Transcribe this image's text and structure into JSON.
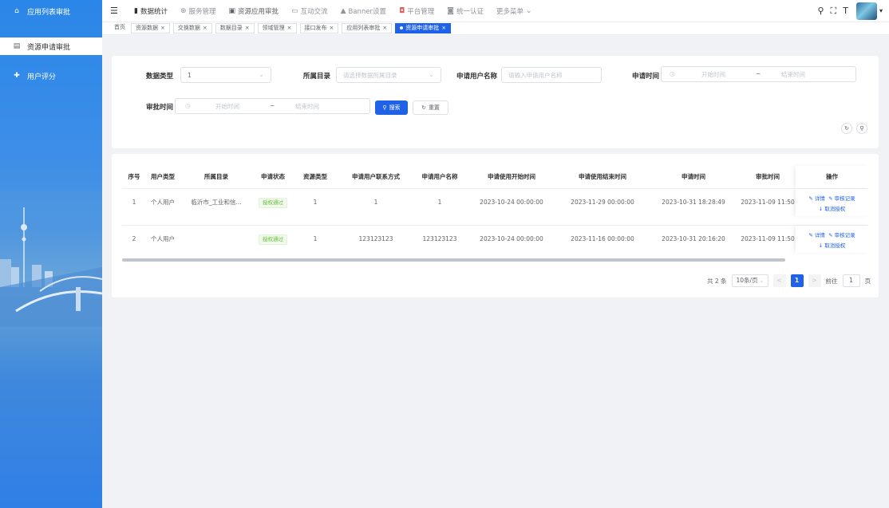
{
  "sidebar": {
    "items": [
      {
        "label": "应用列表审批",
        "icon": "home-icon",
        "glyph": "⌂"
      },
      {
        "label": "资源申请审批",
        "icon": "document-icon",
        "glyph": "▤"
      },
      {
        "label": "用户评分",
        "icon": "plus-icon",
        "glyph": "✚"
      }
    ]
  },
  "topnav": {
    "items": [
      {
        "label": "数据统计",
        "glyph": "▮"
      },
      {
        "label": "服务管理",
        "glyph": "⊕"
      },
      {
        "label": "资源应用审批",
        "glyph": "▣"
      },
      {
        "label": "互动交流",
        "glyph": "▭"
      },
      {
        "label": "Banner设置",
        "glyph": "▲"
      },
      {
        "label": "平台管理",
        "glyph": "◘"
      },
      {
        "label": "统一认证",
        "glyph": "◙"
      },
      {
        "label": "更多菜单",
        "glyph": ""
      }
    ],
    "more_arrow": "⌄"
  },
  "tags": [
    {
      "label": "首页",
      "plain": true
    },
    {
      "label": "资源数据"
    },
    {
      "label": "交换数据"
    },
    {
      "label": "数据目录"
    },
    {
      "label": "领域管理"
    },
    {
      "label": "接口发布"
    },
    {
      "label": "应用列表审批"
    },
    {
      "label": "资源申请审批",
      "active": true
    }
  ],
  "search": {
    "data_type_label": "数据类型",
    "data_type_value": "1",
    "catalog_label": "所属目录",
    "catalog_placeholder": "请选择数据所属目录",
    "user_name_label": "申请用户名称",
    "user_name_placeholder": "请输入申请用户名称",
    "apply_time_label": "申请时间",
    "start_placeholder": "开始时间",
    "range_sep": "~",
    "end_placeholder": "结束时间",
    "approve_time_label": "审批时间",
    "search_button": "搜索",
    "reset_button": "重置"
  },
  "table": {
    "headers": [
      "序号",
      "用户类型",
      "所属目录",
      "申请状态",
      "资源类型",
      "申请用户联系方式",
      "申请用户名称",
      "申请使用开始时间",
      "申请使用结束时间",
      "申请时间",
      "审批时间",
      "操作"
    ],
    "rows": [
      {
        "index": "1",
        "user_type": "个人用户",
        "catalog": "临沂市_工业和信...",
        "status": "授权通过",
        "res_type": "1",
        "contact": "1",
        "user_name": "1",
        "start": "2023-10-24 00:00:00",
        "end": "2023-11-29 00:00:00",
        "apply_time": "2023-10-31 18:28:49",
        "approve_time": "2023-11-09 11:50"
      },
      {
        "index": "2",
        "user_type": "个人用户",
        "catalog": "",
        "status": "授权通过",
        "res_type": "1",
        "contact": "123123123",
        "user_name": "123123123",
        "start": "2023-10-24 00:00:00",
        "end": "2023-11-16 00:00:00",
        "apply_time": "2023-10-31 20:16:20",
        "approve_time": "2023-11-09 11:50"
      }
    ],
    "op_detail": "详情",
    "op_record": "审核记录",
    "op_cancel": "取消授权"
  },
  "pager": {
    "total": "共 2 条",
    "page_size": "10条/页",
    "prev": "<",
    "current": "1",
    "next": ">",
    "goto_prefix": "前往",
    "goto_value": "1",
    "goto_suffix": "页"
  }
}
